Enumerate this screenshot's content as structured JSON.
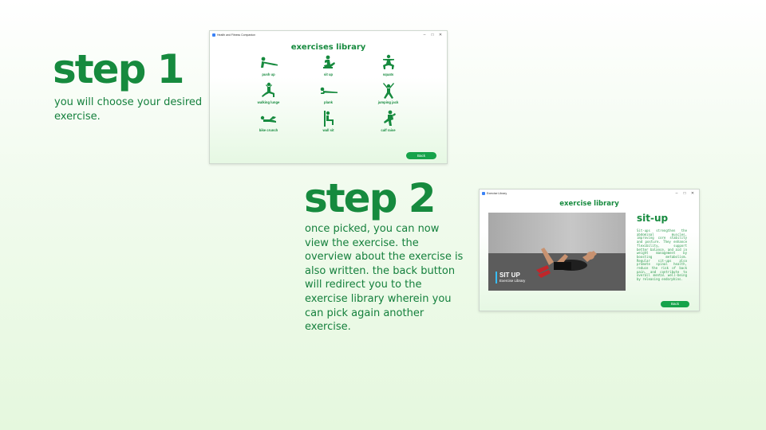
{
  "step1": {
    "title": "step 1",
    "description": "you will choose your desired exercise."
  },
  "step2": {
    "title": "step 2",
    "description": "once picked, you can now view the exercise. the overview about the exercise is also written. the back button will redirect you to the exercise library wherein you can pick again another exercise."
  },
  "library_window": {
    "window_title": "Health and Fitness Companion",
    "heading": "exercises library",
    "exercises": [
      {
        "label": "push up",
        "icon": "push-up-icon"
      },
      {
        "label": "sit up",
        "icon": "sit-up-icon"
      },
      {
        "label": "squats",
        "icon": "squat-icon"
      },
      {
        "label": "walking lunge",
        "icon": "walking-lunge-icon"
      },
      {
        "label": "plank",
        "icon": "plank-icon"
      },
      {
        "label": "jumping jack",
        "icon": "jumping-jack-icon"
      },
      {
        "label": "bike crunch",
        "icon": "bike-crunch-icon"
      },
      {
        "label": "wall sit",
        "icon": "wall-sit-icon"
      },
      {
        "label": "calf raise",
        "icon": "calf-raise-icon"
      }
    ],
    "back_label": "Back"
  },
  "detail_window": {
    "window_title": "Exercise Library",
    "heading": "exercise library",
    "video_title": "SIT UP",
    "video_subtitle": "Exercise Library",
    "exercise_name": "sit-up",
    "overview": "Sit-ups strengthen the abdominal muscles, improving core stability and posture. They enhance flexibility, support better balance, and aid in weight management by boosting metabolism. Regular sit-ups also promote spinal health, reduce the risk of back pain, and contribute to overall mental well-being by releasing endorphins.",
    "back_label": "Back"
  },
  "colors": {
    "accent": "#168a3e",
    "button": "#16a34a",
    "background": "#e5f8de"
  }
}
